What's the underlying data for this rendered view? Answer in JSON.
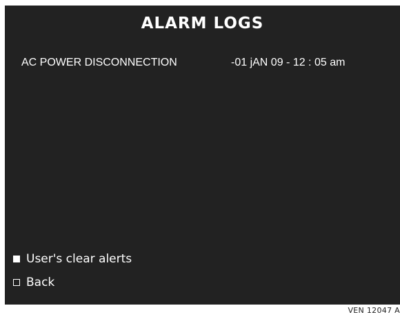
{
  "screen": {
    "title": "ALARM LOGS",
    "background_color": "#222222",
    "text_color": "#ffffff"
  },
  "logs": [
    {
      "event": "AC POWER DISCONNECTION",
      "timestamp": "-01 jAN 09 - 12 : 05 am"
    }
  ],
  "menu": {
    "items": [
      {
        "label": "User's clear alerts",
        "bullet": "filled-square-icon"
      },
      {
        "label": "Back",
        "bullet": "hollow-square-icon"
      }
    ]
  },
  "figure_ref": "VEN 12047 A"
}
